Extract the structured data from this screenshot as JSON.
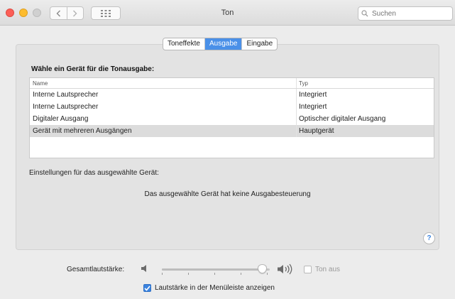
{
  "window": {
    "title": "Ton"
  },
  "toolbar": {
    "back_icon": "chevron-left-icon",
    "forward_icon": "chevron-right-icon",
    "grid_icon": "grid-icon",
    "search_placeholder": "Suchen"
  },
  "tabs": [
    {
      "label": "Toneffekte",
      "active": false
    },
    {
      "label": "Ausgabe",
      "active": true
    },
    {
      "label": "Eingabe",
      "active": false
    }
  ],
  "output": {
    "heading": "Wähle ein Gerät für die Tonausgabe:",
    "columns": {
      "name": "Name",
      "type": "Typ"
    },
    "devices": [
      {
        "name": "Interne Lautsprecher",
        "type": "Integriert",
        "selected": false
      },
      {
        "name": "Interne Lautsprecher",
        "type": "Integriert",
        "selected": false
      },
      {
        "name": "Digitaler Ausgang",
        "type": "Optischer digitaler Ausgang",
        "selected": false
      },
      {
        "name": "Gerät mit mehreren Ausgängen",
        "type": "Hauptgerät",
        "selected": true
      }
    ],
    "settings_label": "Einstellungen für das ausgewählte Gerät:",
    "no_control_message": "Das ausgewählte Gerät hat keine Ausgabesteuerung"
  },
  "help": {
    "label": "?"
  },
  "volume": {
    "label": "Gesamtlautstärke:",
    "level": 0.97,
    "muted": false,
    "mute_label": "Ton aus",
    "menu_bar": {
      "checked": true,
      "label": "Lautstärke in der Menüleiste anzeigen"
    }
  },
  "colors": {
    "accent": "#4a90e8",
    "close": "#fc5f57",
    "minimize": "#fdbc2e",
    "zoom_inactive": "#d0d0d0",
    "selected_row": "#dcdcdc"
  }
}
